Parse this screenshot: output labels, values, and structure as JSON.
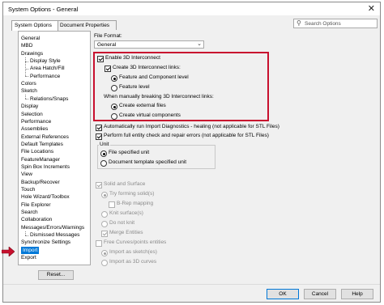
{
  "window": {
    "title": "System Options - General",
    "close_glyph": "✕"
  },
  "tabs": [
    {
      "label": "System Options"
    },
    {
      "label": "Document Properties"
    }
  ],
  "search": {
    "placeholder": "Search Options",
    "icon": "search-icon"
  },
  "tree": {
    "items": [
      {
        "label": "General",
        "indent": 0
      },
      {
        "label": "MBD",
        "indent": 0
      },
      {
        "label": "Drawings",
        "indent": 0
      },
      {
        "label": "Display Style",
        "indent": 1
      },
      {
        "label": "Area Hatch/Fill",
        "indent": 1
      },
      {
        "label": "Performance",
        "indent": 1
      },
      {
        "label": "Colors",
        "indent": 0
      },
      {
        "label": "Sketch",
        "indent": 0
      },
      {
        "label": "Relations/Snaps",
        "indent": 1
      },
      {
        "label": "Display",
        "indent": 0
      },
      {
        "label": "Selection",
        "indent": 0
      },
      {
        "label": "Performance",
        "indent": 0
      },
      {
        "label": "Assemblies",
        "indent": 0
      },
      {
        "label": "External References",
        "indent": 0
      },
      {
        "label": "Default Templates",
        "indent": 0
      },
      {
        "label": "File Locations",
        "indent": 0
      },
      {
        "label": "FeatureManager",
        "indent": 0
      },
      {
        "label": "Spin Box Increments",
        "indent": 0
      },
      {
        "label": "View",
        "indent": 0
      },
      {
        "label": "Backup/Recover",
        "indent": 0
      },
      {
        "label": "Touch",
        "indent": 0
      },
      {
        "label": "Hole Wizard/Toolbox",
        "indent": 0
      },
      {
        "label": "File Explorer",
        "indent": 0
      },
      {
        "label": "Search",
        "indent": 0
      },
      {
        "label": "Collaboration",
        "indent": 0
      },
      {
        "label": "Messages/Errors/Warnings",
        "indent": 0
      },
      {
        "label": "Dismissed Messages",
        "indent": 1
      },
      {
        "label": "Synchronize Settings",
        "indent": 0
      },
      {
        "label": "Import",
        "indent": 0,
        "selected": true
      },
      {
        "label": "Export",
        "indent": 0
      }
    ]
  },
  "reset_button": "Reset...",
  "content": {
    "file_format_label": "File Format:",
    "file_format_value": "General",
    "enable_3d_interconnect": "Enable 3D Interconnect",
    "create_links": "Create 3D Interconnect links:",
    "feature_and_component": "Feature and Component level",
    "feature_level": "Feature level",
    "when_breaking": "When manually breaking 3D Interconnect links:",
    "create_external": "Create external files",
    "create_virtual": "Create virtual components",
    "auto_import_diagnostics": "Automatically run Import Diagnostics - healing (not applicable for STL Files)",
    "perform_full_check": "Perform full entity check and repair errors (not applicable for STL Files)",
    "unit_group": "Unit",
    "file_specified_unit": "File specified unit",
    "doc_template_unit": "Document template specified unit",
    "solid_and_surface": "Solid and Surface",
    "try_forming_solids": "Try forming solid(s)",
    "brep_mapping": "B-Rep mapping",
    "knit_surfaces": "Knit surface(s)",
    "do_not_knit": "Do not knit",
    "merge_entities": "Merge Entities",
    "free_curves": "Free Curves/points entities",
    "import_as_sketch": "Import as sketch(es)",
    "import_as_3d_curves": "Import as 3D curves"
  },
  "footer": {
    "ok": "OK",
    "cancel": "Cancel",
    "help": "Help"
  },
  "colors": {
    "highlight_box": "#c8102e",
    "selection": "#0078d7",
    "arrow": "#c8102e"
  }
}
